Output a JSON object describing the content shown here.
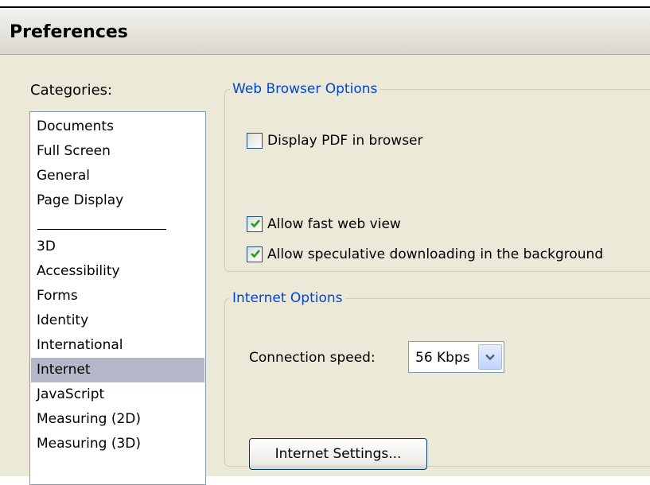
{
  "window": {
    "title": "Preferences"
  },
  "categories": {
    "label": "Categories:",
    "selected": "Internet",
    "items": [
      "Documents",
      "Full Screen",
      "General",
      "Page Display",
      "3D",
      "Accessibility",
      "Forms",
      "Identity",
      "International",
      "Internet",
      "JavaScript",
      "Measuring (2D)",
      "Measuring (3D)"
    ]
  },
  "web_browser_options": {
    "legend": "Web Browser Options",
    "display_pdf": {
      "label": "Display PDF in browser",
      "checked": false
    },
    "fast_web_view": {
      "label": "Allow fast web view",
      "checked": true
    },
    "speculative_download": {
      "label": "Allow speculative downloading in the background",
      "checked": true
    }
  },
  "internet_options": {
    "legend": "Internet Options",
    "connection_speed_label": "Connection speed:",
    "connection_speed_value": "56 Kbps",
    "internet_settings_button": "Internet Settings..."
  },
  "icons": {
    "dropdown": "chevron-down-icon",
    "check": "checkmark-icon"
  },
  "colors": {
    "legend_text": "#0046d5",
    "selection": "#b5b8c8",
    "check": "#21a121",
    "dialog_bg": "#ece9d8"
  }
}
